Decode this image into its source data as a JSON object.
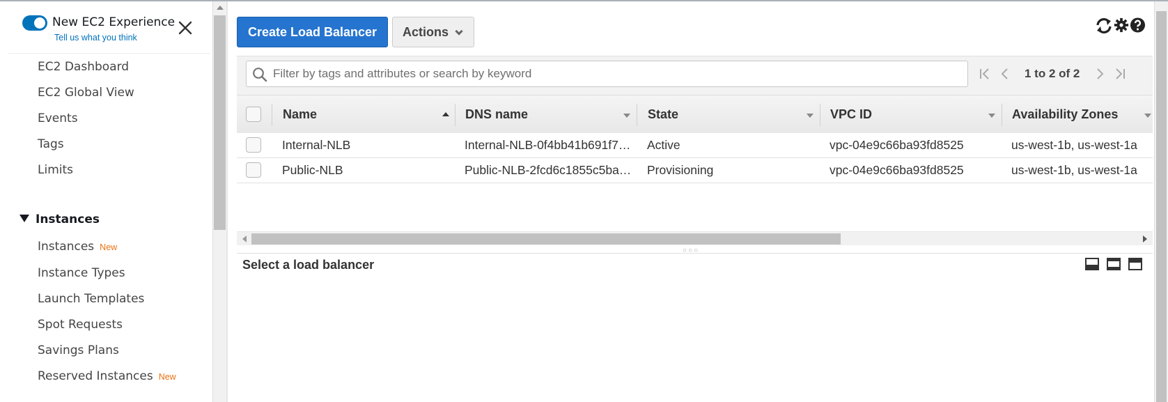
{
  "banner": {
    "title": "New EC2 Experience",
    "link": "Tell us what you think",
    "toggle_on": true
  },
  "sidebar": {
    "items_top": [
      {
        "label": "EC2 Dashboard"
      },
      {
        "label": "EC2 Global View"
      },
      {
        "label": "Events"
      },
      {
        "label": "Tags"
      },
      {
        "label": "Limits"
      }
    ],
    "section": {
      "label": "Instances",
      "expanded": true
    },
    "items_instances": [
      {
        "label": "Instances",
        "badge": "New"
      },
      {
        "label": "Instance Types",
        "badge": ""
      },
      {
        "label": "Launch Templates",
        "badge": ""
      },
      {
        "label": "Spot Requests",
        "badge": ""
      },
      {
        "label": "Savings Plans",
        "badge": ""
      },
      {
        "label": "Reserved Instances",
        "badge": "New"
      }
    ]
  },
  "toolbar": {
    "create_label": "Create Load Balancer",
    "actions_label": "Actions",
    "icons": [
      "refresh-icon",
      "gear-icon",
      "help-icon"
    ]
  },
  "search": {
    "placeholder": "Filter by tags and attributes or search by keyword",
    "value": ""
  },
  "pagination": {
    "text": "1 to 2 of 2"
  },
  "table": {
    "columns": [
      "Name",
      "DNS name",
      "State",
      "VPC ID",
      "Availability Zones"
    ],
    "sorted_column": "Name",
    "sort_direction": "ascending",
    "rows": [
      {
        "name": "Internal-NLB",
        "dns": "Internal-NLB-0f4bb41b691f7…",
        "state": "Active",
        "vpc": "vpc-04e9c66ba93fd8525",
        "az": "us-west-1b, us-west-1a"
      },
      {
        "name": "Public-NLB",
        "dns": "Public-NLB-2fcd6c1855c5ba…",
        "state": "Provisioning",
        "vpc": "vpc-04e9c66ba93fd8525",
        "az": "us-west-1b, us-west-1a"
      }
    ]
  },
  "detail": {
    "title": "Select a load balancer"
  },
  "colors": {
    "primary_button": "#2574cf",
    "toggle": "#0073bb",
    "new_badge": "#ec7211",
    "link": "#0073bb"
  }
}
